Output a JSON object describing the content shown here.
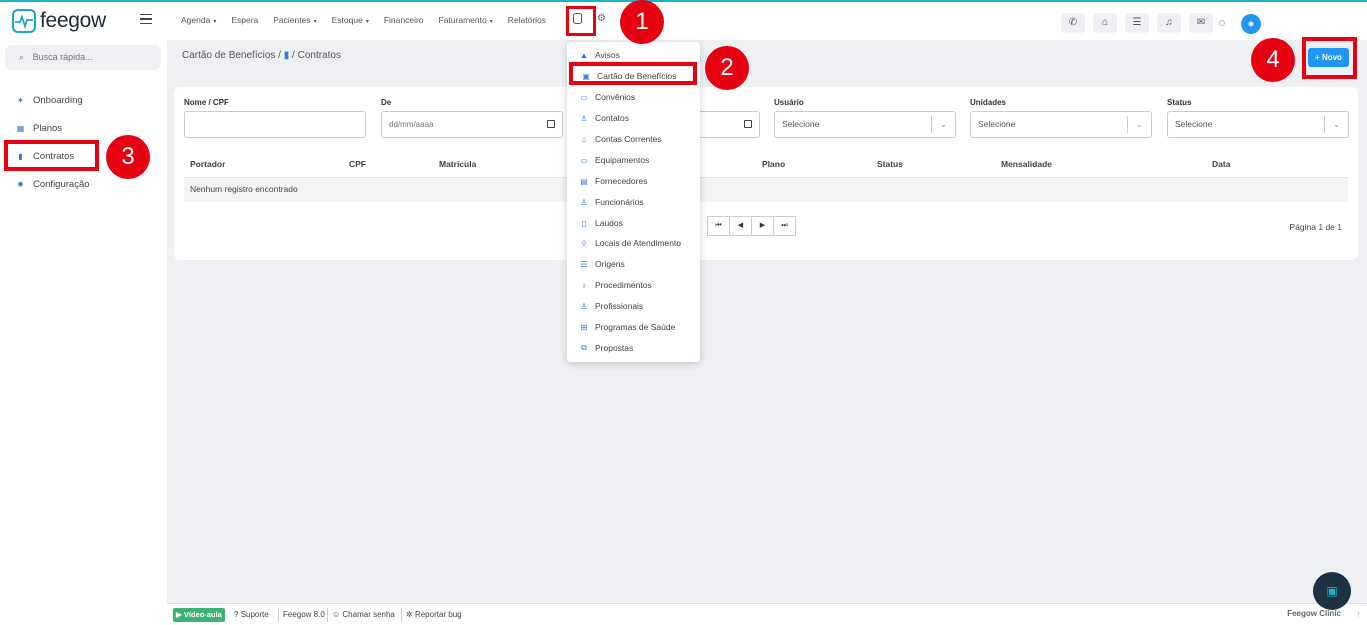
{
  "brand": {
    "name": "feegow",
    "accent": "#1ab3c8",
    "red": "#e60012",
    "blue": "#2196f3"
  },
  "nav": {
    "items": [
      {
        "label": "Agenda",
        "dropdown": true
      },
      {
        "label": "Espera",
        "dropdown": false
      },
      {
        "label": "Pacientes",
        "dropdown": true
      },
      {
        "label": "Estoque",
        "dropdown": true
      },
      {
        "label": "Financeiro",
        "dropdown": false
      },
      {
        "label": "Faturamento",
        "dropdown": true
      },
      {
        "label": "Relatórios",
        "dropdown": false
      }
    ],
    "caret": "▾"
  },
  "badges": {
    "one": "1",
    "two": "2",
    "three": "3",
    "four": "4"
  },
  "sidebar": {
    "search_placeholder": "Busca rápida...",
    "items": [
      {
        "label": "Onboarding",
        "icon": "rocket-icon"
      },
      {
        "label": "Planos",
        "icon": "table-icon"
      },
      {
        "label": "Contratos",
        "icon": "document-icon"
      },
      {
        "label": "Configuração",
        "icon": "gear-icon"
      }
    ]
  },
  "breadcrumb": {
    "parent": "Cartão de Benefícios",
    "sep": "/",
    "current": "Contratos"
  },
  "novo_button": "+ Novo",
  "filters": {
    "nome_cpf": {
      "label": "Nome / CPF",
      "value": ""
    },
    "de": {
      "label": "De",
      "placeholder": "dd/mm/aaaa"
    },
    "ate": {
      "label": "",
      "placeholder": ""
    },
    "usuario": {
      "label": "Usuário",
      "value": "Selecione"
    },
    "unidades": {
      "label": "Unidades",
      "value": "Selecione"
    },
    "status": {
      "label": "Status",
      "value": "Selecione"
    }
  },
  "table": {
    "columns": [
      "Portador",
      "CPF",
      "Matrícula",
      "Plano",
      "Status",
      "Mensalidade",
      "Data"
    ],
    "empty": "Nenhum registro encontrado",
    "page_info": "Página 1 de 1"
  },
  "pager": {
    "first": "⏮",
    "prev": "◀",
    "next": "▶",
    "last": "⏭"
  },
  "dropdown": {
    "items": [
      "Avisos",
      "Cartão de Benefícios",
      "Convênios",
      "Contatos",
      "Contas Correntes",
      "Equipamentos",
      "Fornecedores",
      "Funcionários",
      "Laudos",
      "Locais de Atendimento",
      "Origens",
      "Procedimentos",
      "Profissionais",
      "Programas de Saúde",
      "Propostas"
    ]
  },
  "footer": {
    "video": "Vídeo-aula",
    "suporte": "Suporte",
    "version": "Feegow 8.0",
    "chamar": "Chamar senha",
    "bug": "Reportar bug",
    "clinic": "Feegow Clinic"
  }
}
